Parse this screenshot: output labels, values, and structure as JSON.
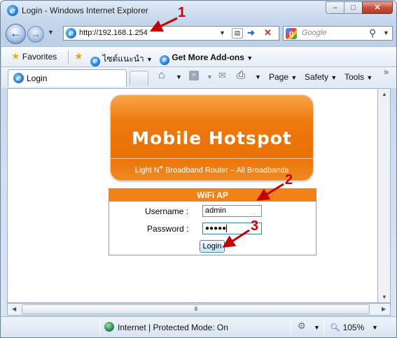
{
  "window": {
    "title": "Login - Windows Internet Explorer",
    "controls": {
      "minimize": "–",
      "maximize": "□",
      "close": "✕"
    }
  },
  "nav": {
    "back_icon": "back-arrow-icon",
    "forward_icon": "forward-arrow-icon",
    "address": "http://192.168.1.254",
    "search_placeholder": "Google",
    "search_icon": "magnifier-icon"
  },
  "favorites_bar": {
    "favorites_label": "Favorites",
    "suggested_sites": "ไซต์แนะนำ",
    "get_addons": "Get More Add-ons"
  },
  "tab": {
    "label": "Login"
  },
  "command_bar": {
    "page": "Page",
    "safety": "Safety",
    "tools": "Tools",
    "overflow": "»"
  },
  "banner": {
    "title": "Mobile Hotspot",
    "subtitle_prefix": "Light N",
    "subtitle_sup": "+",
    "subtitle_rest": " Broadband Router – All Broadbands"
  },
  "login": {
    "header": "WiFi AP",
    "username_label": "Username :",
    "username_value": "admin",
    "password_label": "Password :",
    "password_mask": "●●●●●",
    "button_label": "Login"
  },
  "annotations": {
    "step1": "1",
    "step2": "2",
    "step3": "3",
    "color": "#c40000"
  },
  "scroll": {
    "hthumb_grip": "III"
  },
  "status": {
    "zone": "Internet | Protected Mode: On",
    "zoom": "105%"
  }
}
